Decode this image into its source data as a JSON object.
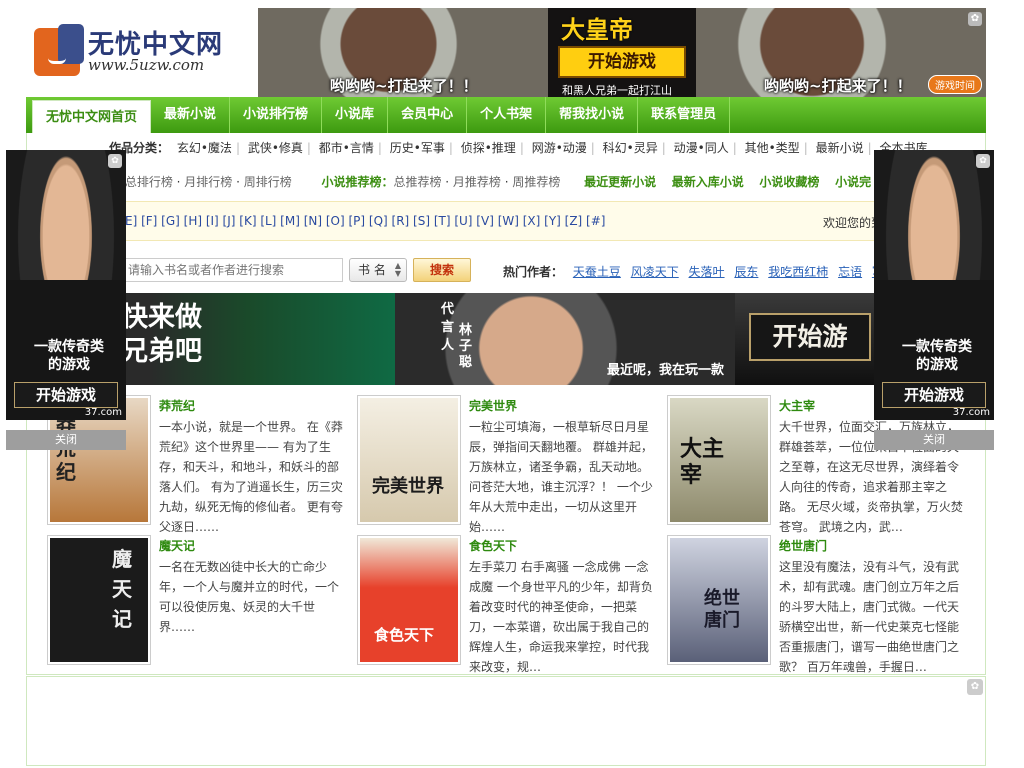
{
  "site": {
    "logo_title": "无忧中文网",
    "logo_url": "www.5uzw.com"
  },
  "top_ad": {
    "caption_left": "哟哟哟~打起来了！！",
    "caption_right": "哟哟哟~打起来了！！",
    "emperor": "大皇帝",
    "start_button": "开始游戏",
    "subtitle": "和黑人兄弟一起打江山",
    "link_label": "游戏时间",
    "corner_icon": "paw-icon"
  },
  "nav": {
    "items": [
      {
        "label": "无忧中文网首页",
        "active": true
      },
      {
        "label": "最新小说"
      },
      {
        "label": "小说排行榜"
      },
      {
        "label": "小说库"
      },
      {
        "label": "会员中心"
      },
      {
        "label": "个人书架"
      },
      {
        "label": "帮我找小说"
      },
      {
        "label": "联系管理员"
      }
    ]
  },
  "categories": {
    "heading": "作品分类：",
    "items": [
      "玄幻•魔法",
      "武侠•修真",
      "都市•言情",
      "历史•军事",
      "侦探•推理",
      "网游•动漫",
      "科幻•灵异",
      "动漫•同人",
      "其他•类型",
      "最新小说",
      "全本书库"
    ]
  },
  "rank_bar": {
    "group1": [
      "总排行榜",
      "月排行榜",
      "周排行榜"
    ],
    "recommend_title": "小说推荐榜：",
    "group2": [
      "总推荐榜",
      "月推荐榜",
      "周推荐榜"
    ],
    "links": [
      "最近更新小说",
      "最新入库小说",
      "小说收藏榜",
      "小说完"
    ]
  },
  "alphabet": {
    "letters": "E] [F] [G] [H] [I] [J] [K] [L] [M] [N] [O] [P] [Q] [R] [S] [T] [U] [V] [W] [X] [Y] [Z] [#]",
    "welcome": "欢迎您的到"
  },
  "search": {
    "placeholder": "请输入书名或者作者进行搜索",
    "select_value": "书 名",
    "button_label": "搜索",
    "hot_label": "热门作者：",
    "hot_authors": [
      "天蚕土豆",
      "风凌天下",
      "失落叶",
      "辰东",
      "我吃西红柿",
      "忘语",
      "写字"
    ]
  },
  "banner": {
    "left_text_line1": "快来做",
    "left_text_line2": "兄弟吧",
    "spokesman_label": "代言人",
    "spokesman_name": "林子聪",
    "caption": "最近呢，我在玩一款",
    "start_button": "开始游"
  },
  "books": [
    {
      "title": "莽荒纪",
      "cover_text": "莽荒纪",
      "desc": "一本小说，就是一个世界。 在《莽荒纪》这个世界里—— 有为了生存，和天斗，和地斗，和妖斗的部落人们。 有为了逍遥长生，历三灾九劫，纵死无悔的修仙者。 更有夸父逐日……",
      "cover_color": "#d8c0a8"
    },
    {
      "title": "完美世界",
      "cover_text": "完美世界",
      "desc": "一粒尘可填海，一根草斩尽日月星辰，弹指间天翻地覆。 群雄并起，万族林立，诸圣争霸，乱天动地。问苍茫大地，谁主沉浮？！ 一个少年从大荒中走出，一切从这里开始……",
      "cover_color": "#efe6d2"
    },
    {
      "title": "大主宰",
      "cover_text": "大主宰",
      "desc": "大千世界，位面交汇，万族林立，群雄荟萃，一位位来自下位面的天之至尊，在这无尽世界，演绎着令人向往的传奇，追求着那主宰之路。 无尽火域，炎帝执掌，万火焚苍穹。 武境之内，武…",
      "cover_color": "#b9b8a2"
    },
    {
      "title": "魔天记",
      "cover_text": "魔天记",
      "desc": "一名在无数凶徒中长大的亡命少年，一个人与魔并立的时代，一个可以役使厉鬼、妖灵的大千世界……",
      "cover_color": "#1b1b1b"
    },
    {
      "title": "食色天下",
      "cover_text": "食色天下",
      "desc": "左手菜刀 右手离骚 一念成佛 一念成魔 一个身世平凡的少年，却背负着改变时代的神圣使命，一把菜刀，一本菜谱，砍出属于我自己的辉煌人生，命运我来掌控，时代我来改变，规…",
      "cover_color": "#e7412b"
    },
    {
      "title": "绝世唐门",
      "cover_text": "绝世唐门",
      "desc": "这里没有魔法，没有斗气，没有武术，却有武魂。唐门创立万年之后的斗罗大陆上，唐门式微。一代天骄横空出世，新一代史莱克七怪能否重振唐门，谱写一曲绝世唐门之歌？ 百万年魂兽，手握日…",
      "cover_color": "#5a6078"
    }
  ],
  "side_ad": {
    "text_line1": "一款传奇类",
    "text_line2": "的游戏",
    "button": "开始游戏",
    "brand": "37.com",
    "close_label": "关闭"
  }
}
